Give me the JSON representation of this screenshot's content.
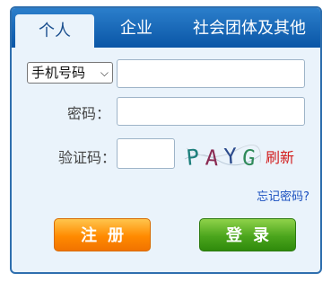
{
  "tabs": [
    {
      "label": "个人",
      "active": true
    },
    {
      "label": "企业",
      "active": false
    },
    {
      "label": "社会团体及其他",
      "active": false
    }
  ],
  "form": {
    "account_type": "手机号码",
    "account_value": "",
    "password_label": "密码：",
    "password_value": "",
    "captcha_label": "验证码：",
    "captcha_value": "",
    "captcha_text": "PAYG",
    "refresh_label": "刷新",
    "forgot_label": "忘记密码?"
  },
  "buttons": {
    "register_label": "注册",
    "login_label": "登录"
  },
  "colors": {
    "tab_bar": "#0a56a6",
    "panel_bg": "#eaf3fb",
    "register": "#ff8a00",
    "login": "#4ba51c",
    "refresh": "#d21c1c",
    "link": "#1a4fbf"
  }
}
